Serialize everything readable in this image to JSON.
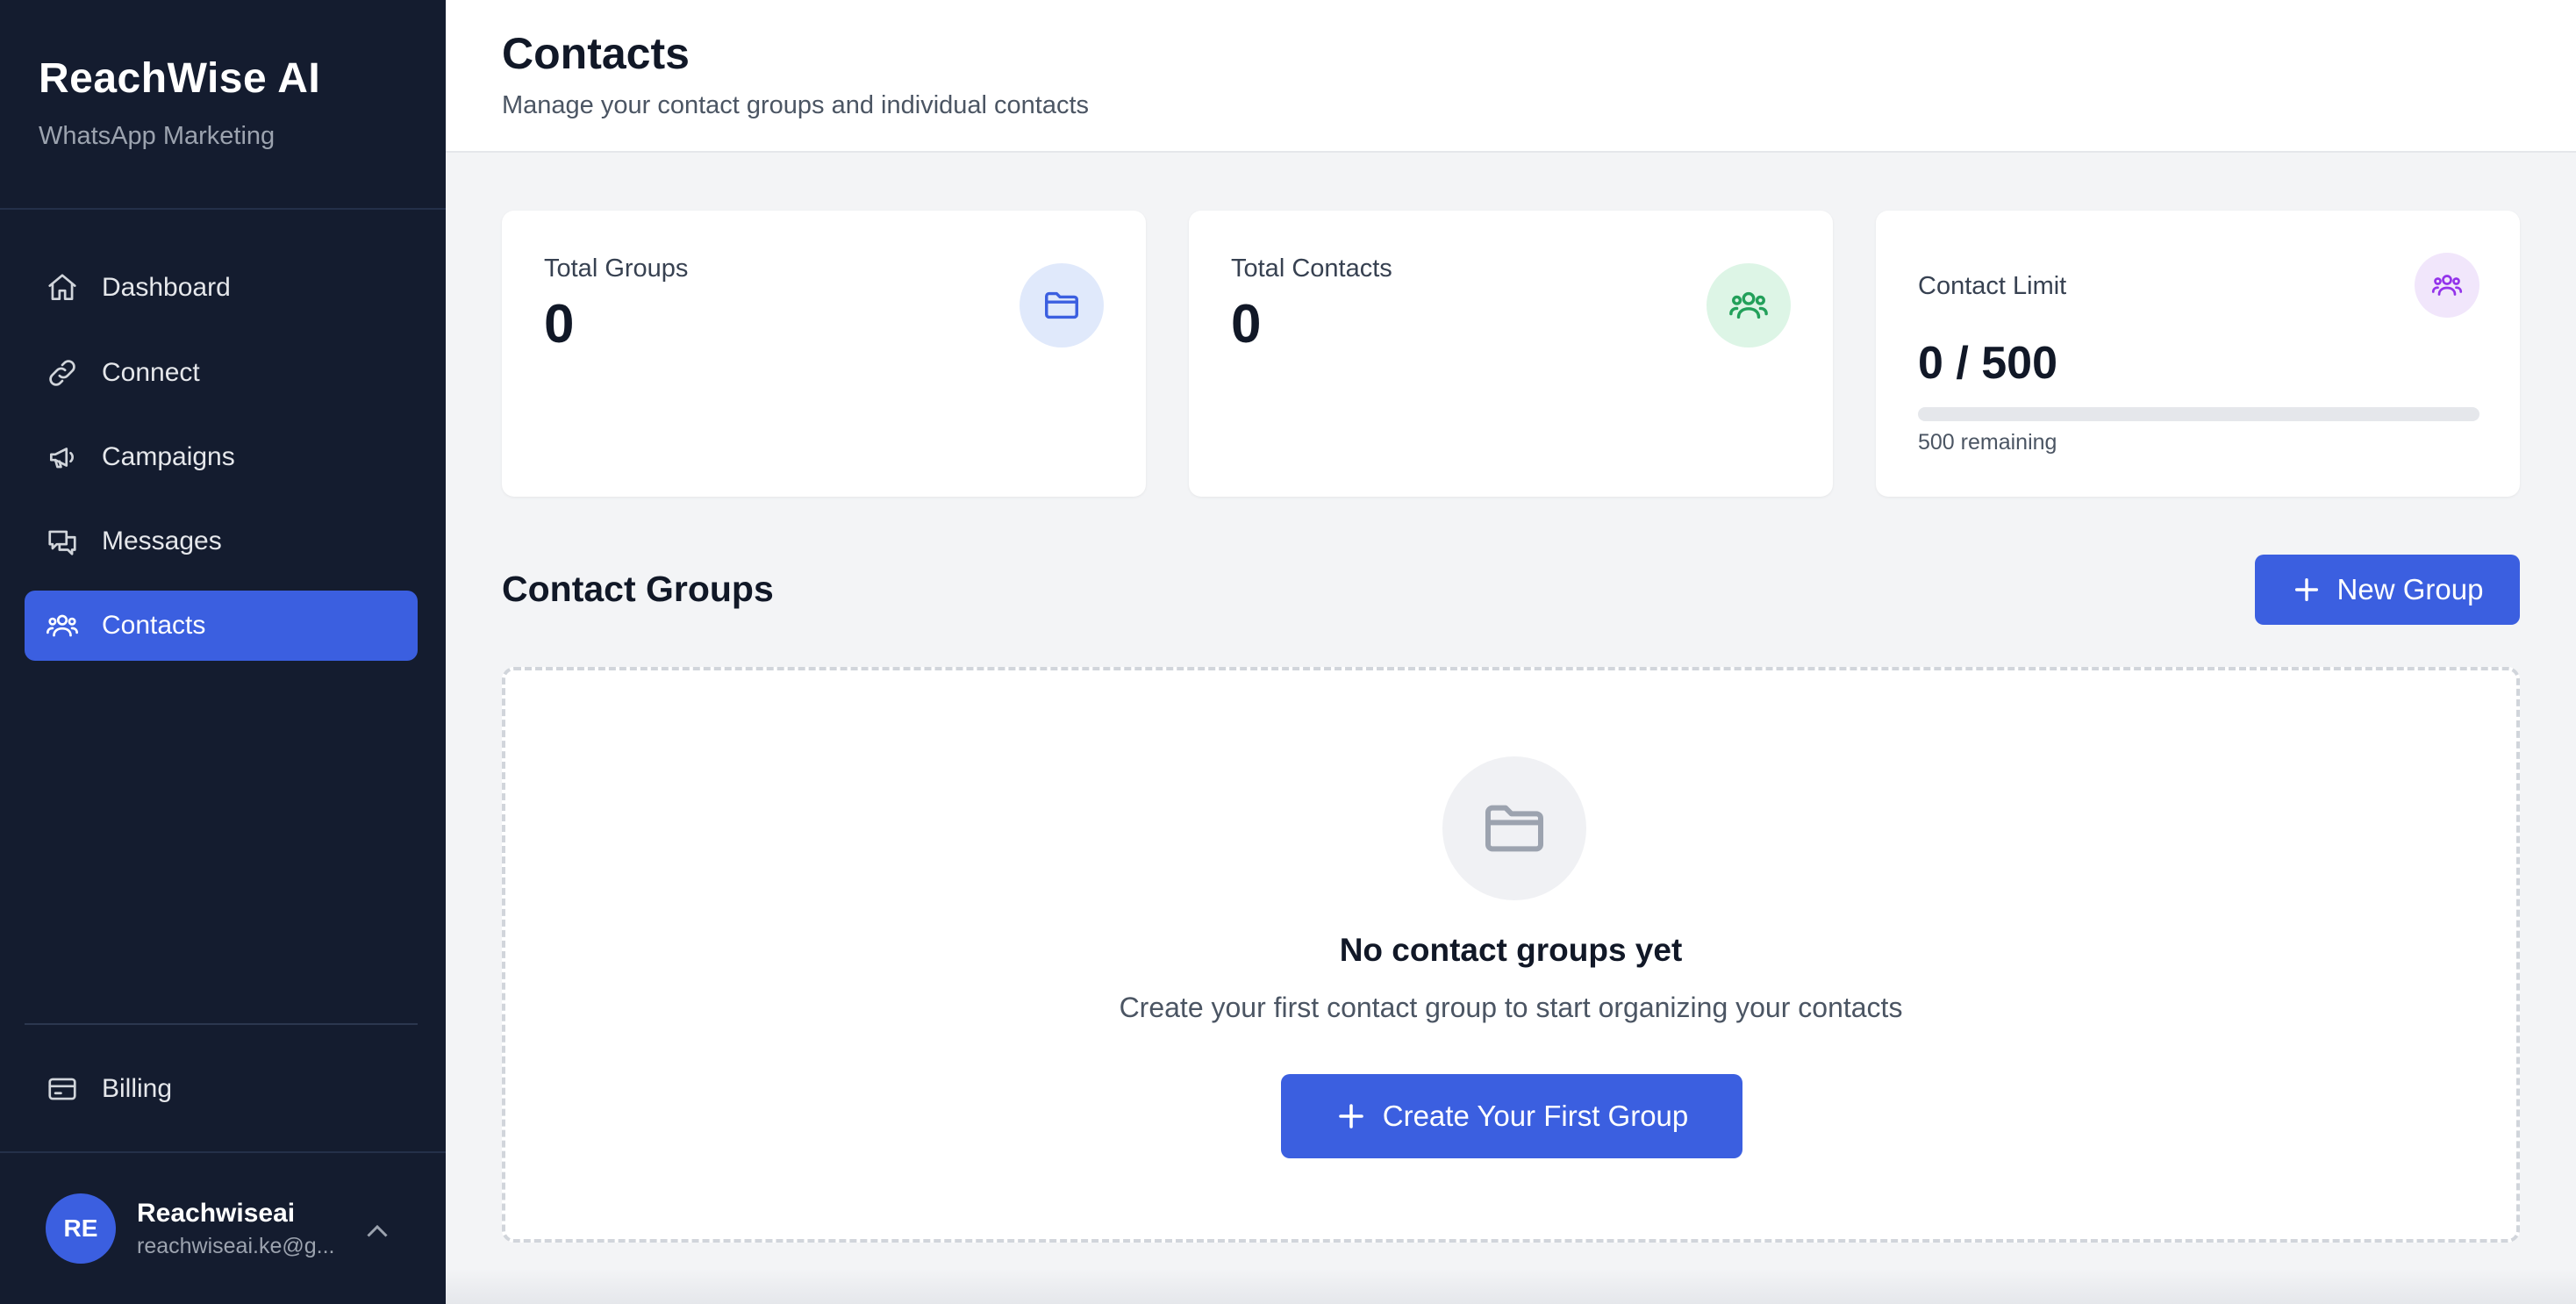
{
  "brand": {
    "title": "ReachWise AI",
    "subtitle": "WhatsApp Marketing"
  },
  "sidebar": {
    "items": [
      {
        "label": "Dashboard",
        "icon": "home-icon"
      },
      {
        "label": "Connect",
        "icon": "link-icon"
      },
      {
        "label": "Campaigns",
        "icon": "megaphone-icon"
      },
      {
        "label": "Messages",
        "icon": "chat-icon"
      },
      {
        "label": "Contacts",
        "icon": "users-icon",
        "active": true
      }
    ],
    "billing": {
      "label": "Billing",
      "icon": "credit-card-icon"
    }
  },
  "user": {
    "initials": "RE",
    "name": "Reachwiseai",
    "email": "reachwiseai.ke@g..."
  },
  "header": {
    "title": "Contacts",
    "subtitle": "Manage your contact groups and individual contacts"
  },
  "stats": {
    "groups": {
      "label": "Total Groups",
      "value": "0",
      "icon": "folder-icon"
    },
    "contacts": {
      "label": "Total Contacts",
      "value": "0",
      "icon": "users-icon"
    },
    "limit": {
      "label": "Contact Limit",
      "value": "0 / 500",
      "used": 0,
      "max": 500,
      "remaining": "500 remaining",
      "icon": "users-icon"
    }
  },
  "groups_section": {
    "title": "Contact Groups",
    "new_button": "New Group",
    "empty_title": "No contact groups yet",
    "empty_subtitle": "Create your first contact group to start organizing your contacts",
    "create_button": "Create Your First Group"
  },
  "colors": {
    "sidebar_bg": "#141c2f",
    "accent": "#3b5fe0",
    "page_bg": "#f3f4f6"
  }
}
